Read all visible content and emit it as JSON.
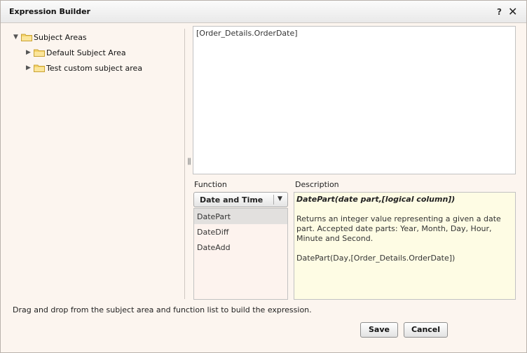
{
  "dialog": {
    "title": "Expression Builder",
    "help_glyph": "?",
    "close_glyph": "✕"
  },
  "tree": {
    "root": {
      "label": "Subject Areas",
      "expanded": true
    },
    "children": [
      {
        "label": "Default Subject Area",
        "expanded": false
      },
      {
        "label": "Test custom subject area",
        "expanded": false
      }
    ]
  },
  "expression": {
    "value": "[Order_Details.OrderDate]"
  },
  "function": {
    "label": "Function",
    "selected_category": "Date and Time",
    "items": [
      {
        "label": "DatePart",
        "selected": true
      },
      {
        "label": "DateDiff",
        "selected": false
      },
      {
        "label": "DateAdd",
        "selected": false
      }
    ]
  },
  "description": {
    "label": "Description",
    "signature": "DatePart(date part,[logical column])",
    "text": "Returns an integer value representing a given a date part. Accepted date parts: Year, Month, Day, Hour, Minute and Second.",
    "example": "DatePart(Day,[Order_Details.OrderDate])"
  },
  "footer": {
    "hint": "Drag and drop from the subject area and function list to build the expression.",
    "save_label": "Save",
    "cancel_label": "Cancel"
  },
  "icons": {
    "folder_color": "#f2c94c",
    "expand_collapse": "triangle-icon"
  }
}
